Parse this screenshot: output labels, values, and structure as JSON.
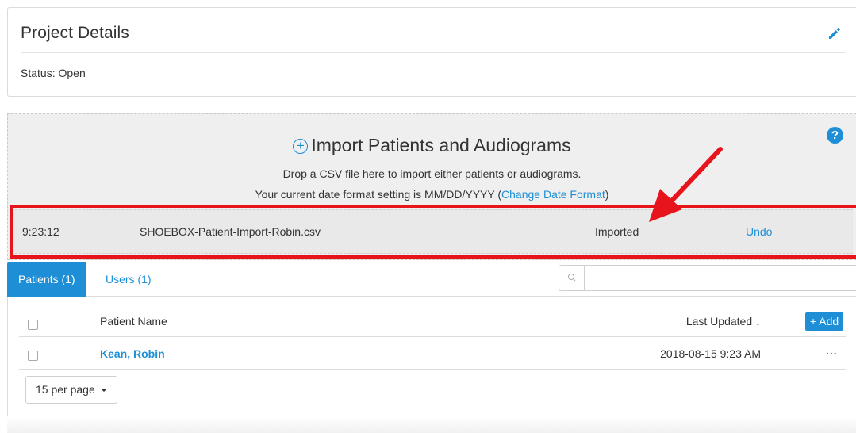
{
  "project": {
    "title": "Project Details",
    "status_label": "Status:",
    "status_value": "Open"
  },
  "import": {
    "title": "Import Patients and Audiograms",
    "description": "Drop a CSV file here to import either patients or audiograms.",
    "date_format_prefix": "Your current date format setting is MM/DD/YYYY (",
    "date_format_link": "Change Date Format",
    "date_format_suffix": ")",
    "help_glyph": "?",
    "row": {
      "time": "9:23:12",
      "filename": "SHOEBOX-Patient-Import-Robin.csv",
      "status": "Imported",
      "undo_label": "Undo"
    }
  },
  "tabs": [
    {
      "label": "Patients (1)",
      "active": true
    },
    {
      "label": "Users (1)",
      "active": false
    }
  ],
  "search": {
    "placeholder": ""
  },
  "table": {
    "headers": {
      "name": "Patient Name",
      "updated": "Last Updated ↓"
    },
    "add_label": "+ Add",
    "rows": [
      {
        "name": "Kean, Robin",
        "updated": "2018-08-15 9:23 AM",
        "more": "..."
      }
    ]
  },
  "pagination": {
    "per_page_label": "15 per page"
  },
  "colors": {
    "accent": "#1e8fd6",
    "highlight": "#e8141b"
  },
  "icons": {
    "edit": "pencil-icon",
    "help": "help-icon",
    "search": "search-icon",
    "import": "plus-circle-icon"
  }
}
